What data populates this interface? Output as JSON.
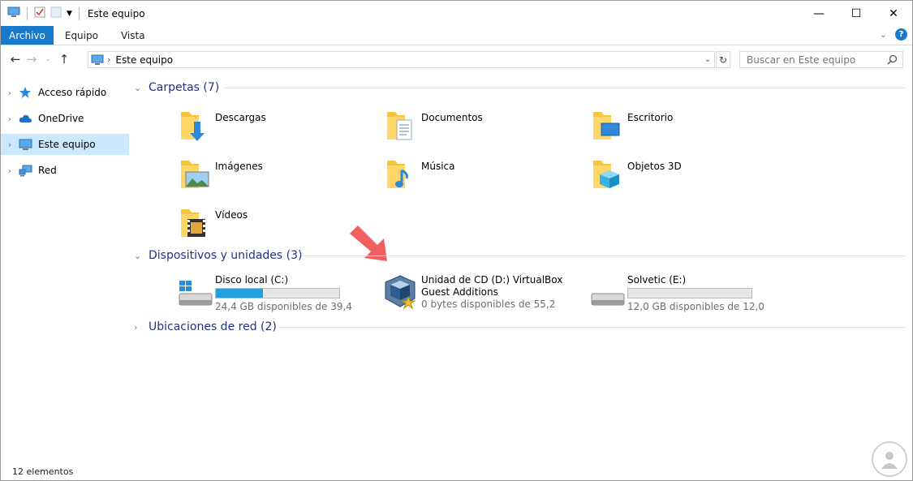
{
  "titlebar": {
    "title": "Este equipo",
    "controls": {
      "minimize": "—",
      "maximize": "☐",
      "close": "✕"
    }
  },
  "ribbon": {
    "tabs": [
      "Archivo",
      "Equipo",
      "Vista"
    ],
    "help": "?",
    "accent": "#1979ca"
  },
  "navbar": {
    "address": "Este equipo",
    "search_placeholder": "Buscar en Este equipo"
  },
  "sidebar": {
    "items": [
      {
        "label": "Acceso rápido",
        "icon": "star-icon"
      },
      {
        "label": "OneDrive",
        "icon": "cloud-icon"
      },
      {
        "label": "Este equipo",
        "icon": "computer-icon",
        "selected": true
      },
      {
        "label": "Red",
        "icon": "network-icon"
      }
    ]
  },
  "groups": {
    "folders_header": "Carpetas (7)",
    "devices_header": "Dispositivos y unidades (3)",
    "network_header": "Ubicaciones de red (2)"
  },
  "folders": [
    {
      "name": "Descargas",
      "icon": "downloads-folder-icon"
    },
    {
      "name": "Documentos",
      "icon": "documents-folder-icon"
    },
    {
      "name": "Escritorio",
      "icon": "desktop-folder-icon"
    },
    {
      "name": "Imágenes",
      "icon": "pictures-folder-icon"
    },
    {
      "name": "Música",
      "icon": "music-folder-icon"
    },
    {
      "name": "Objetos 3D",
      "icon": "3d-objects-folder-icon"
    },
    {
      "name": "Vídeos",
      "icon": "videos-folder-icon"
    }
  ],
  "drives": [
    {
      "name": "Disco local (C:)",
      "free": "24,4 GB disponibles de 39,4",
      "used_fraction": 0.38,
      "icon": "windows-drive-icon"
    },
    {
      "name_line1": "Unidad de CD (D:) VirtualBox",
      "name_line2": "Guest Additions",
      "free": "0 bytes disponibles de 55,2",
      "icon": "virtualbox-cd-icon"
    },
    {
      "name": "Solvetic (E:)",
      "free": "12,0 GB disponibles de 12,0",
      "used_fraction": 0.0,
      "icon": "usb-drive-icon"
    }
  ],
  "status": {
    "count": "12 elementos"
  },
  "colors": {
    "header_text": "#1e3287",
    "selection": "#cce8ff",
    "bar_fill": "#26a0da",
    "arrow": "#f06060"
  }
}
